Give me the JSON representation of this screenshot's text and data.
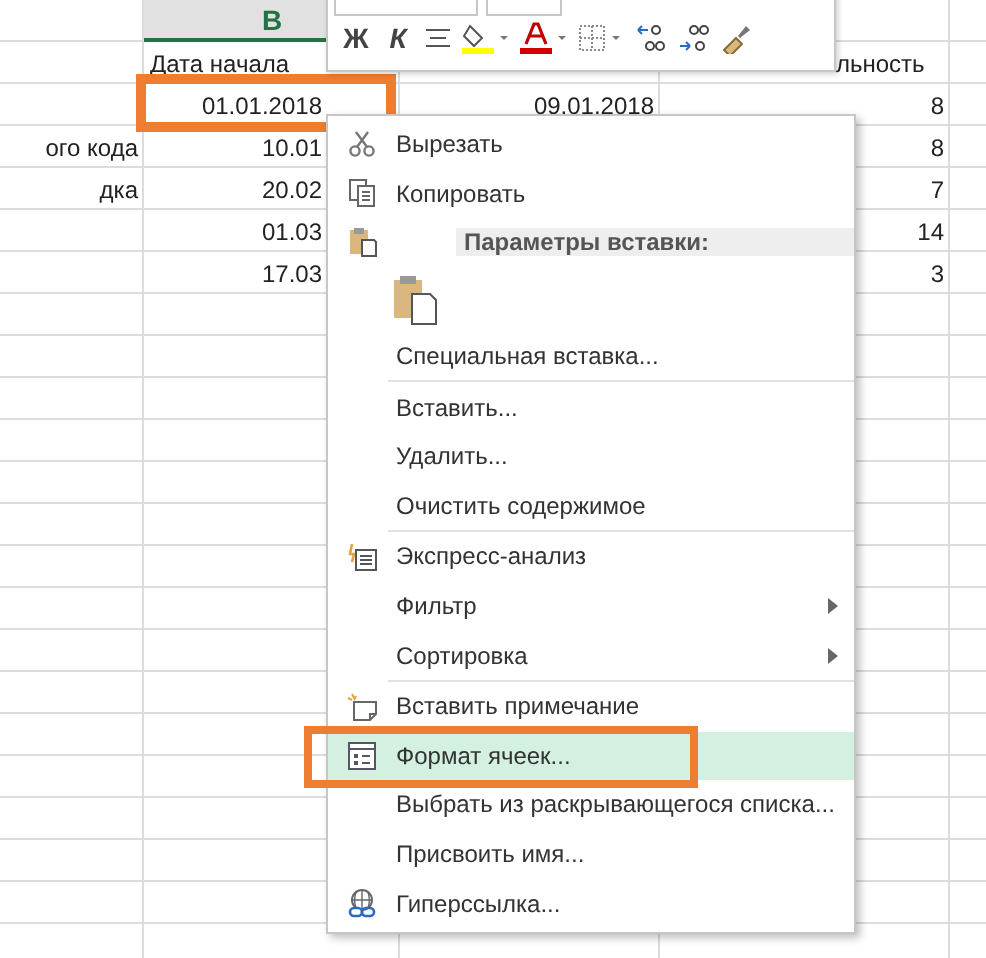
{
  "sheet": {
    "column_header": {
      "label": "B",
      "selected": true
    },
    "rows": [
      {
        "b": "Дата начала",
        "d": "льность",
        "outlined": false
      },
      {
        "b": "01.01.2018",
        "c": "09.01.2018",
        "d": "8",
        "outlined": true
      },
      {
        "a": "ого кода",
        "b": "10.01",
        "d": "8",
        "outlined": false
      },
      {
        "a": "дка",
        "b": "20.02",
        "d": "7",
        "outlined": false
      },
      {
        "b": "01.03",
        "d": "14",
        "outlined": false
      },
      {
        "b": "17.03",
        "d": "3",
        "outlined": false
      }
    ]
  },
  "mini_toolbar": {
    "buttons": [
      "Ж",
      "К"
    ]
  },
  "context_menu": {
    "items": [
      {
        "kind": "item",
        "label": "Вырезать",
        "selected": false,
        "submenu": false,
        "outlined": false
      },
      {
        "kind": "item",
        "label": "Копировать",
        "selected": false,
        "submenu": false,
        "outlined": false
      },
      {
        "kind": "heading",
        "label": "Параметры вставки:"
      },
      {
        "kind": "paste"
      },
      {
        "kind": "item",
        "label": "Специальная вставка...",
        "selected": false,
        "submenu": false,
        "outlined": false
      },
      {
        "kind": "separator"
      },
      {
        "kind": "item",
        "label": "Вставить...",
        "selected": false,
        "submenu": false,
        "outlined": false
      },
      {
        "kind": "item",
        "label": "Удалить...",
        "selected": false,
        "submenu": false,
        "outlined": false
      },
      {
        "kind": "item",
        "label": "Очистить содержимое",
        "selected": false,
        "submenu": false,
        "outlined": false
      },
      {
        "kind": "separator"
      },
      {
        "kind": "item",
        "label": "Экспресс-анализ",
        "selected": false,
        "submenu": false,
        "outlined": false
      },
      {
        "kind": "item",
        "label": "Фильтр",
        "selected": false,
        "submenu": true,
        "outlined": false
      },
      {
        "kind": "item",
        "label": "Сортировка",
        "selected": false,
        "submenu": true,
        "outlined": false
      },
      {
        "kind": "separator"
      },
      {
        "kind": "item",
        "label": "Вставить примечание",
        "selected": false,
        "submenu": false,
        "outlined": false
      },
      {
        "kind": "item",
        "label": "Формат ячеек...",
        "selected": true,
        "submenu": false,
        "outlined": true
      },
      {
        "kind": "item",
        "label": "Выбрать из раскрывающегося списка...",
        "selected": false,
        "submenu": false,
        "outlined": false
      },
      {
        "kind": "item",
        "label": "Присвоить имя...",
        "selected": false,
        "submenu": false,
        "outlined": false
      },
      {
        "kind": "item",
        "label": "Гиперссылка...",
        "selected": false,
        "submenu": false,
        "outlined": false
      }
    ]
  }
}
